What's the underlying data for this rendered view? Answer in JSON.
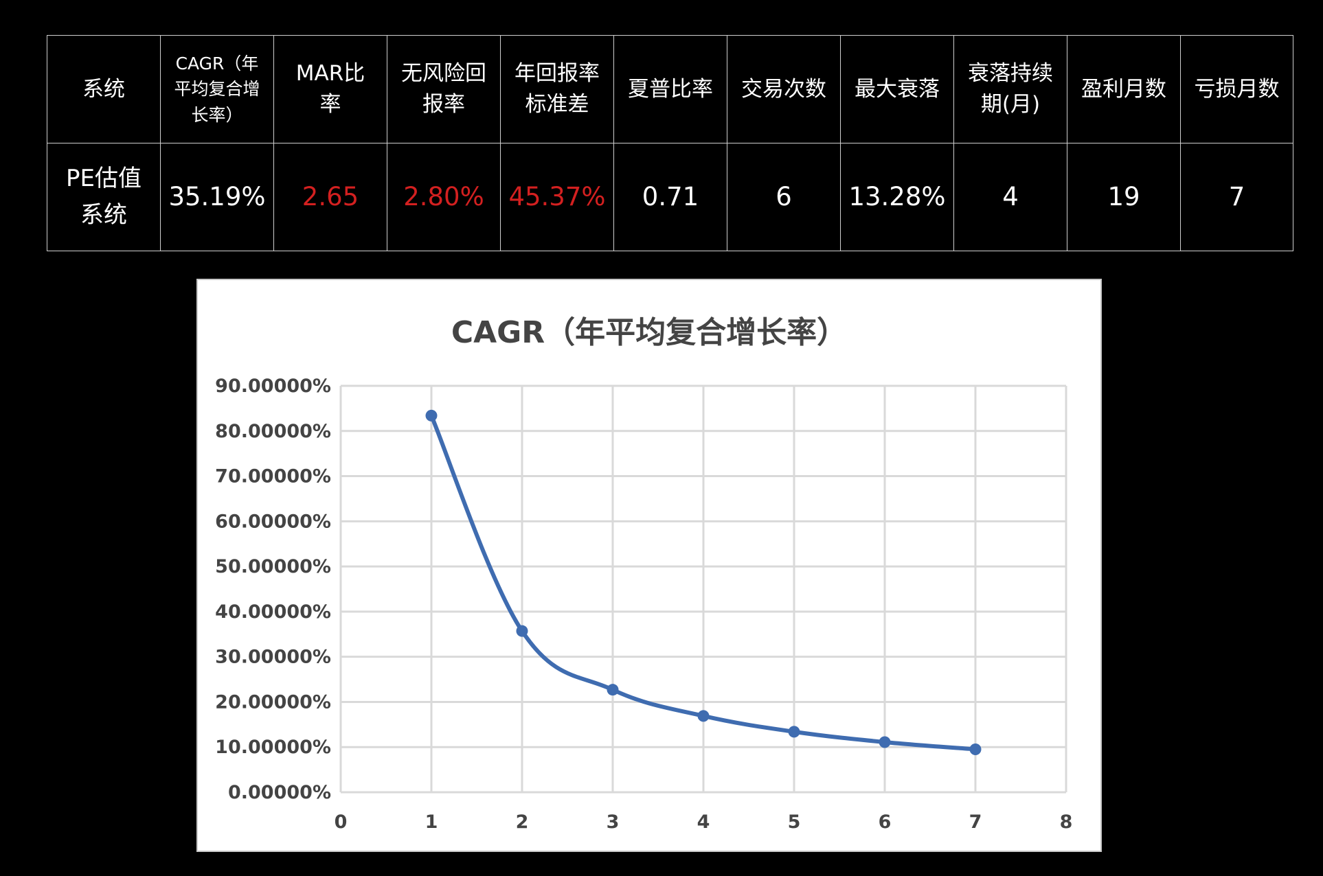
{
  "table": {
    "headers": [
      "系统",
      "CAGR（年平均复合增长率）",
      "MAR比率",
      "无风险回报率",
      "年回报率标准差",
      "夏普比率",
      "交易次数",
      "最大衰落",
      "衰落持续期(月)",
      "盈利月数",
      "亏损月数"
    ],
    "header_lines": [
      [
        "系统"
      ],
      [
        "CAGR（年",
        "平均复合增",
        "长率）"
      ],
      [
        "MAR比",
        "率"
      ],
      [
        "无风险回",
        "报率"
      ],
      [
        "年回报率",
        "标准差"
      ],
      [
        "夏普比率"
      ],
      [
        "交易次数"
      ],
      [
        "最大衰落"
      ],
      [
        "衰落持续",
        "期(月)"
      ],
      [
        "盈利月数"
      ],
      [
        "亏损月数"
      ]
    ],
    "row": {
      "name_lines": [
        "PE估值",
        "系统"
      ],
      "values": [
        "35.19%",
        "2.65",
        "2.80%",
        "45.37%",
        "0.71",
        "6",
        "13.28%",
        "4",
        "19",
        "7"
      ],
      "highlight_color": "#d32020"
    }
  },
  "chart_data": {
    "type": "line",
    "title": "CAGR（年平均复合增长率）",
    "x": [
      1,
      2,
      3,
      4,
      5,
      6,
      7
    ],
    "y": [
      0.834,
      0.357,
      0.227,
      0.169,
      0.134,
      0.111,
      0.095
    ],
    "xlim": [
      0,
      8
    ],
    "ylim": [
      0,
      0.9
    ],
    "x_ticks": [
      "0",
      "1",
      "2",
      "3",
      "4",
      "5",
      "6",
      "7",
      "8"
    ],
    "y_ticks": [
      "0.00000%",
      "10.00000%",
      "20.00000%",
      "30.00000%",
      "40.00000%",
      "50.00000%",
      "60.00000%",
      "70.00000%",
      "80.00000%",
      "90.00000%"
    ],
    "grid": true,
    "line_color": "#3f6cb0",
    "grid_color": "#d9d9d9"
  }
}
